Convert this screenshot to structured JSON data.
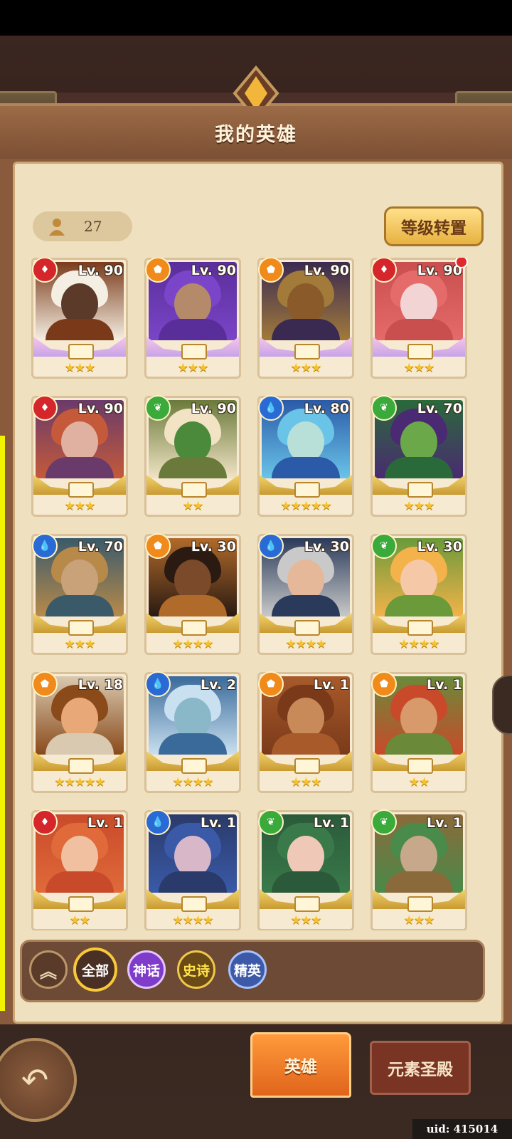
{
  "header": {
    "title": "我的英雄"
  },
  "hero_count": "27",
  "level_swap_button": "等级转置",
  "heroes": [
    {
      "level": "Lv. 90",
      "element": "fire",
      "stars": "★★★",
      "rarity": "myth",
      "palette": [
        "#7a3a1a",
        "#f5efe3",
        "#5b3a2a"
      ]
    },
    {
      "level": "Lv. 90",
      "element": "light",
      "stars": "★★★",
      "rarity": "myth",
      "palette": [
        "#5a2e9a",
        "#7a45c8",
        "#b48a6a"
      ]
    },
    {
      "level": "Lv. 90",
      "element": "light",
      "stars": "★★★",
      "rarity": "myth",
      "palette": [
        "#3a2a52",
        "#a27a3a",
        "#8a5a2a"
      ]
    },
    {
      "level": "Lv. 90",
      "element": "fire",
      "stars": "★★★",
      "rarity": "myth",
      "palette": [
        "#c94e4e",
        "#e56a6a",
        "#f2d4d4"
      ]
    },
    {
      "level": "Lv. 90",
      "element": "fire",
      "stars": "★★★",
      "rarity": "legend",
      "palette": [
        "#6a3a6a",
        "#c45a3a",
        "#e0b0a0"
      ]
    },
    {
      "level": "Lv. 90",
      "element": "nature",
      "stars": "★★",
      "rarity": "legend",
      "palette": [
        "#6a7a3a",
        "#f1e3c4",
        "#4a8a3a"
      ]
    },
    {
      "level": "Lv. 80",
      "element": "water",
      "stars": "★★★★★",
      "rarity": "legend",
      "palette": [
        "#2a5aa8",
        "#6ac4e8",
        "#b8e0d8"
      ]
    },
    {
      "level": "Lv. 70",
      "element": "nature",
      "stars": "★★★",
      "rarity": "legend",
      "palette": [
        "#2a6a3a",
        "#4a2a72",
        "#6aa84a"
      ]
    },
    {
      "level": "Lv. 70",
      "element": "water",
      "stars": "★★★",
      "rarity": "legend",
      "palette": [
        "#3a5a6a",
        "#b88a4a",
        "#c9a27a"
      ]
    },
    {
      "level": "Lv. 30",
      "element": "light",
      "stars": "★★★★",
      "rarity": "legend",
      "palette": [
        "#b06a2a",
        "#2a1a12",
        "#7a4a2a"
      ]
    },
    {
      "level": "Lv. 30",
      "element": "water",
      "stars": "★★★★",
      "rarity": "legend",
      "palette": [
        "#2a3a5a",
        "#c9c9c9",
        "#e6b89a"
      ]
    },
    {
      "level": "Lv. 30",
      "element": "nature",
      "stars": "★★★★",
      "rarity": "legend",
      "palette": [
        "#6a9a3a",
        "#f3b24a",
        "#f5c8a8"
      ]
    },
    {
      "level": "Lv. 18",
      "element": "light",
      "stars": "★★★★★",
      "rarity": "legend",
      "palette": [
        "#d9c9b0",
        "#8a4a1a",
        "#e8a878"
      ]
    },
    {
      "level": "Lv. 2",
      "element": "water",
      "stars": "★★★★",
      "rarity": "legend",
      "palette": [
        "#3a6a9a",
        "#c9e0f0",
        "#8ab8c8"
      ]
    },
    {
      "level": "Lv. 1",
      "element": "light",
      "stars": "★★★",
      "rarity": "legend",
      "palette": [
        "#a85a2a",
        "#7a3a1a",
        "#c98a5a"
      ]
    },
    {
      "level": "Lv. 1",
      "element": "light",
      "stars": "★★",
      "rarity": "legend",
      "palette": [
        "#6a8a3a",
        "#c94a2a",
        "#d89a6a"
      ]
    },
    {
      "level": "Lv. 1",
      "element": "fire",
      "stars": "★★",
      "rarity": "legend",
      "palette": [
        "#c94a2a",
        "#e06a3a",
        "#f0c0a0"
      ]
    },
    {
      "level": "Lv. 1",
      "element": "water",
      "stars": "★★★★",
      "rarity": "legend",
      "palette": [
        "#2a3a6a",
        "#3a5aa8",
        "#d8b8c8"
      ]
    },
    {
      "level": "Lv. 1",
      "element": "nature",
      "stars": "★★★",
      "rarity": "legend",
      "palette": [
        "#2a5a3a",
        "#3a7a4a",
        "#f0c8b8"
      ]
    },
    {
      "level": "Lv. 1",
      "element": "nature",
      "stars": "★★★",
      "rarity": "legend",
      "palette": [
        "#8a6a3a",
        "#4a8a4a",
        "#c8a88a"
      ]
    }
  ],
  "filters": {
    "all": "全部",
    "myth": "神话",
    "epic": "史诗",
    "elite": "精英"
  },
  "tabs": {
    "heroes": "英雄",
    "temple": "元素圣殿"
  },
  "uid": "uid: 415014",
  "colors": {
    "fire": "#d4262b",
    "light": "#f08a1a",
    "water": "#2a6ad4",
    "nature": "#3aaa3a"
  }
}
